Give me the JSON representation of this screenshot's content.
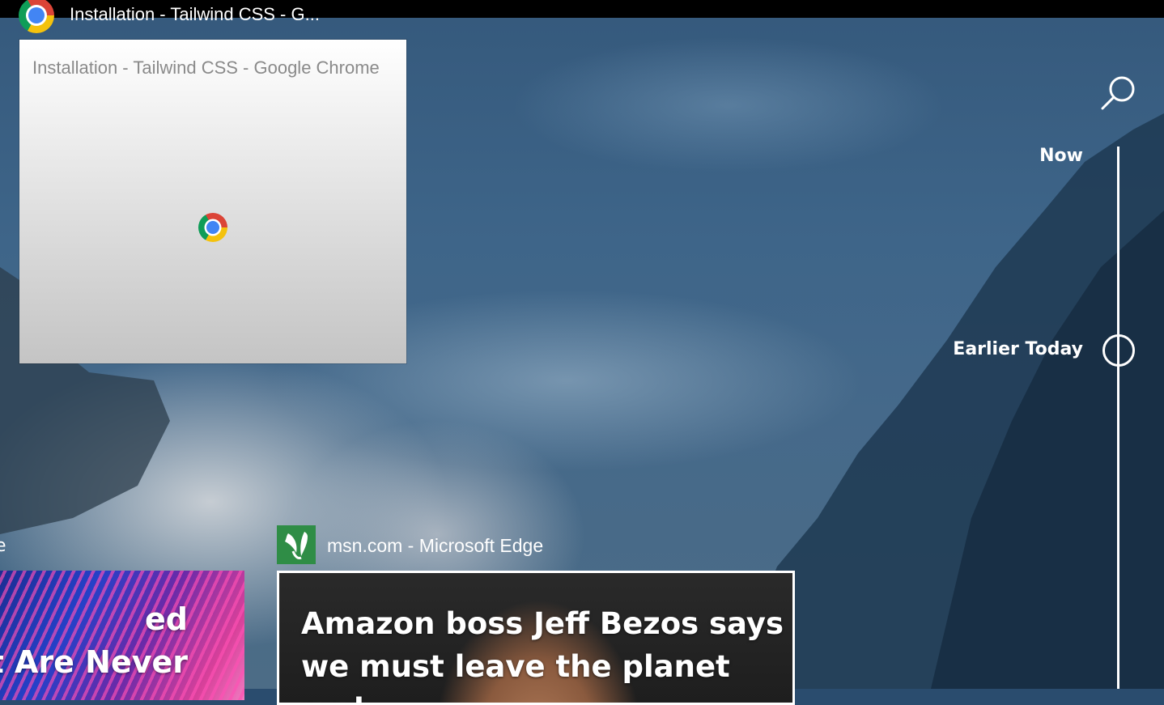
{
  "window": {
    "caption_title": "Installation - Tailwind CSS - G...",
    "caption_icon": "chrome-icon"
  },
  "thumbnail": {
    "title": "Installation - Tailwind CSS - Google Chrome",
    "icon": "chrome-icon"
  },
  "search": {
    "icon": "search-icon"
  },
  "timeline": {
    "labels": [
      "Now",
      "Earlier Today"
    ],
    "selected": "Earlier Today"
  },
  "activities": {
    "left_card": {
      "edge_char": "e",
      "text_line1": "ed",
      "text_line2": "at Are Never"
    },
    "main_card": {
      "source_label": "msn.com - Microsoft Edge",
      "source_icon": "msn-butterfly-icon",
      "headline_line1": "Amazon boss Jeff Bezos says",
      "headline_line2": "we must leave the planet and"
    }
  },
  "colors": {
    "caption_bar": "#000000",
    "msn_green": "#2f8d46",
    "timeline": "#ffffff"
  }
}
